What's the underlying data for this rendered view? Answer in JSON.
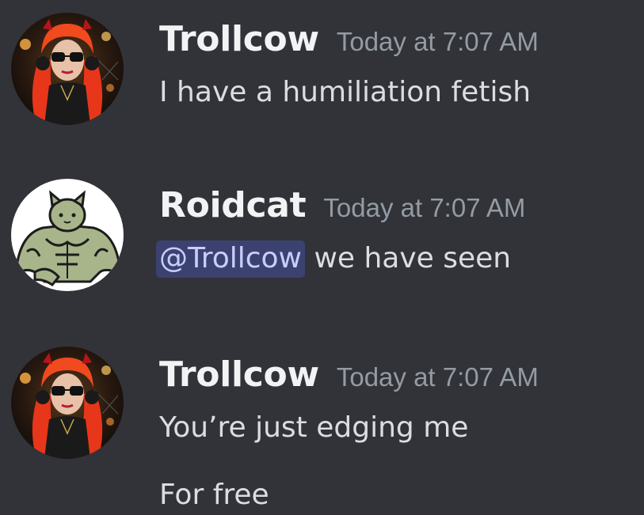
{
  "messages": [
    {
      "username": "Trollcow",
      "timestamp": "Today at 7:07 AM",
      "avatar_icon": "redhead-sunglasses-avatar",
      "lines": [
        "I have a humiliation fetish"
      ]
    },
    {
      "username": "Roidcat",
      "timestamp": "Today at 7:07 AM",
      "avatar_icon": "muscular-cat-avatar",
      "mention": "@Trollcow",
      "text_after_mention": " we have seen"
    },
    {
      "username": "Trollcow",
      "timestamp": "Today at 7:07 AM",
      "avatar_icon": "redhead-sunglasses-avatar",
      "lines": [
        "You’re just edging me",
        "For free"
      ]
    }
  ],
  "colors": {
    "background": "#313338",
    "username": "#f2f3f5",
    "timestamp": "#949ba4",
    "message_text": "#dbdee1",
    "mention_bg": "#3c4270",
    "mention_text": "#c9cdfb"
  }
}
